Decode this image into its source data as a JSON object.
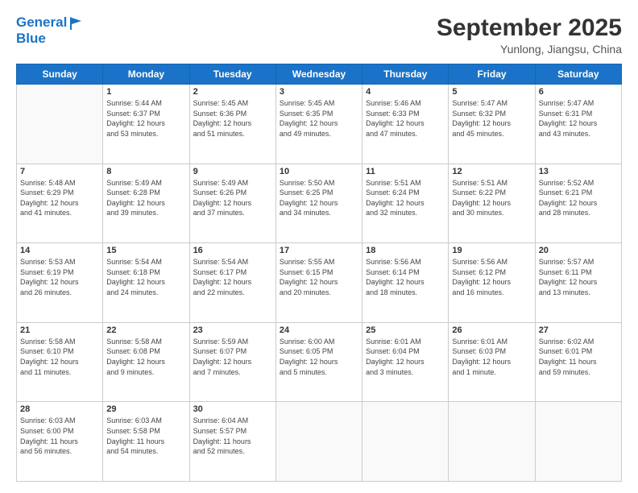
{
  "header": {
    "logo_line1": "General",
    "logo_line2": "Blue",
    "month_title": "September 2025",
    "location": "Yunlong, Jiangsu, China"
  },
  "weekdays": [
    "Sunday",
    "Monday",
    "Tuesday",
    "Wednesday",
    "Thursday",
    "Friday",
    "Saturday"
  ],
  "weeks": [
    [
      {
        "day": "",
        "info": ""
      },
      {
        "day": "1",
        "info": "Sunrise: 5:44 AM\nSunset: 6:37 PM\nDaylight: 12 hours\nand 53 minutes."
      },
      {
        "day": "2",
        "info": "Sunrise: 5:45 AM\nSunset: 6:36 PM\nDaylight: 12 hours\nand 51 minutes."
      },
      {
        "day": "3",
        "info": "Sunrise: 5:45 AM\nSunset: 6:35 PM\nDaylight: 12 hours\nand 49 minutes."
      },
      {
        "day": "4",
        "info": "Sunrise: 5:46 AM\nSunset: 6:33 PM\nDaylight: 12 hours\nand 47 minutes."
      },
      {
        "day": "5",
        "info": "Sunrise: 5:47 AM\nSunset: 6:32 PM\nDaylight: 12 hours\nand 45 minutes."
      },
      {
        "day": "6",
        "info": "Sunrise: 5:47 AM\nSunset: 6:31 PM\nDaylight: 12 hours\nand 43 minutes."
      }
    ],
    [
      {
        "day": "7",
        "info": "Sunrise: 5:48 AM\nSunset: 6:29 PM\nDaylight: 12 hours\nand 41 minutes."
      },
      {
        "day": "8",
        "info": "Sunrise: 5:49 AM\nSunset: 6:28 PM\nDaylight: 12 hours\nand 39 minutes."
      },
      {
        "day": "9",
        "info": "Sunrise: 5:49 AM\nSunset: 6:26 PM\nDaylight: 12 hours\nand 37 minutes."
      },
      {
        "day": "10",
        "info": "Sunrise: 5:50 AM\nSunset: 6:25 PM\nDaylight: 12 hours\nand 34 minutes."
      },
      {
        "day": "11",
        "info": "Sunrise: 5:51 AM\nSunset: 6:24 PM\nDaylight: 12 hours\nand 32 minutes."
      },
      {
        "day": "12",
        "info": "Sunrise: 5:51 AM\nSunset: 6:22 PM\nDaylight: 12 hours\nand 30 minutes."
      },
      {
        "day": "13",
        "info": "Sunrise: 5:52 AM\nSunset: 6:21 PM\nDaylight: 12 hours\nand 28 minutes."
      }
    ],
    [
      {
        "day": "14",
        "info": "Sunrise: 5:53 AM\nSunset: 6:19 PM\nDaylight: 12 hours\nand 26 minutes."
      },
      {
        "day": "15",
        "info": "Sunrise: 5:54 AM\nSunset: 6:18 PM\nDaylight: 12 hours\nand 24 minutes."
      },
      {
        "day": "16",
        "info": "Sunrise: 5:54 AM\nSunset: 6:17 PM\nDaylight: 12 hours\nand 22 minutes."
      },
      {
        "day": "17",
        "info": "Sunrise: 5:55 AM\nSunset: 6:15 PM\nDaylight: 12 hours\nand 20 minutes."
      },
      {
        "day": "18",
        "info": "Sunrise: 5:56 AM\nSunset: 6:14 PM\nDaylight: 12 hours\nand 18 minutes."
      },
      {
        "day": "19",
        "info": "Sunrise: 5:56 AM\nSunset: 6:12 PM\nDaylight: 12 hours\nand 16 minutes."
      },
      {
        "day": "20",
        "info": "Sunrise: 5:57 AM\nSunset: 6:11 PM\nDaylight: 12 hours\nand 13 minutes."
      }
    ],
    [
      {
        "day": "21",
        "info": "Sunrise: 5:58 AM\nSunset: 6:10 PM\nDaylight: 12 hours\nand 11 minutes."
      },
      {
        "day": "22",
        "info": "Sunrise: 5:58 AM\nSunset: 6:08 PM\nDaylight: 12 hours\nand 9 minutes."
      },
      {
        "day": "23",
        "info": "Sunrise: 5:59 AM\nSunset: 6:07 PM\nDaylight: 12 hours\nand 7 minutes."
      },
      {
        "day": "24",
        "info": "Sunrise: 6:00 AM\nSunset: 6:05 PM\nDaylight: 12 hours\nand 5 minutes."
      },
      {
        "day": "25",
        "info": "Sunrise: 6:01 AM\nSunset: 6:04 PM\nDaylight: 12 hours\nand 3 minutes."
      },
      {
        "day": "26",
        "info": "Sunrise: 6:01 AM\nSunset: 6:03 PM\nDaylight: 12 hours\nand 1 minute."
      },
      {
        "day": "27",
        "info": "Sunrise: 6:02 AM\nSunset: 6:01 PM\nDaylight: 11 hours\nand 59 minutes."
      }
    ],
    [
      {
        "day": "28",
        "info": "Sunrise: 6:03 AM\nSunset: 6:00 PM\nDaylight: 11 hours\nand 56 minutes."
      },
      {
        "day": "29",
        "info": "Sunrise: 6:03 AM\nSunset: 5:58 PM\nDaylight: 11 hours\nand 54 minutes."
      },
      {
        "day": "30",
        "info": "Sunrise: 6:04 AM\nSunset: 5:57 PM\nDaylight: 11 hours\nand 52 minutes."
      },
      {
        "day": "",
        "info": ""
      },
      {
        "day": "",
        "info": ""
      },
      {
        "day": "",
        "info": ""
      },
      {
        "day": "",
        "info": ""
      }
    ]
  ]
}
